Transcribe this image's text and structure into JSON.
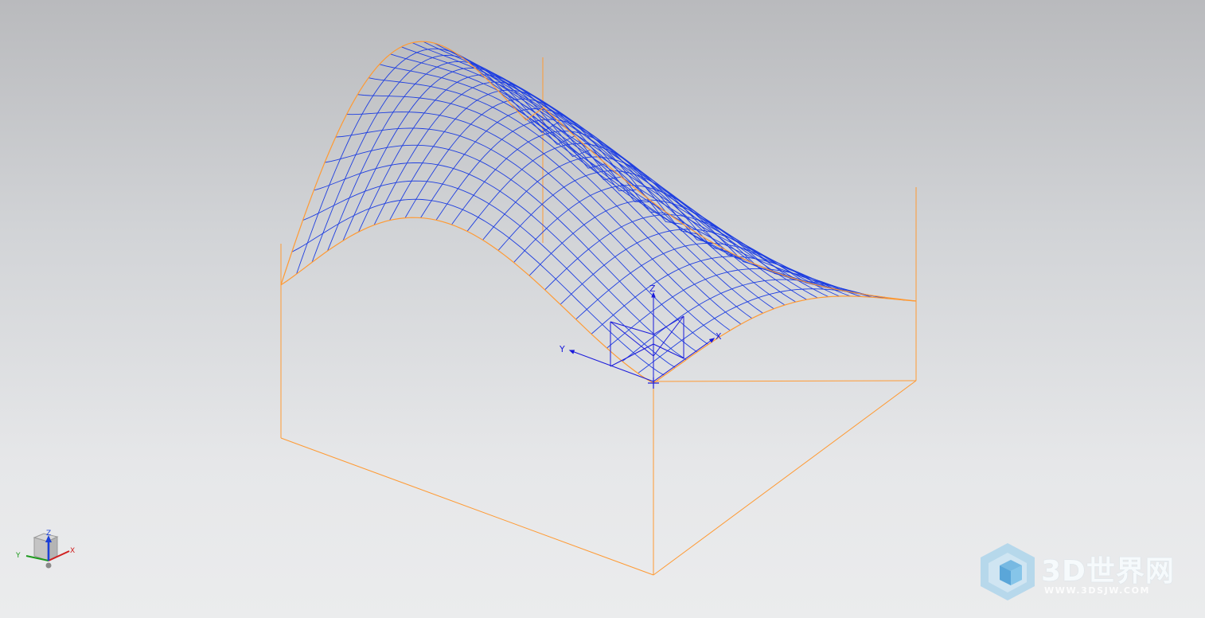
{
  "viewport": {
    "colors": {
      "background_top": "#b9babd",
      "background_bottom": "#ebeced",
      "bounding_box": "#ff9a33",
      "surface_grid": "#1f3fe0",
      "csys": "#1a1adb"
    },
    "wcs": {
      "x_label": "X",
      "y_label": "Y",
      "z_label": "Z"
    },
    "view_triad": {
      "x_label": "X",
      "y_label": "Y",
      "z_label": "Z"
    }
  },
  "watermark": {
    "title": "3D世界网",
    "url": "WWW.3DSJW.COM",
    "icon": "cube-logo-icon"
  }
}
